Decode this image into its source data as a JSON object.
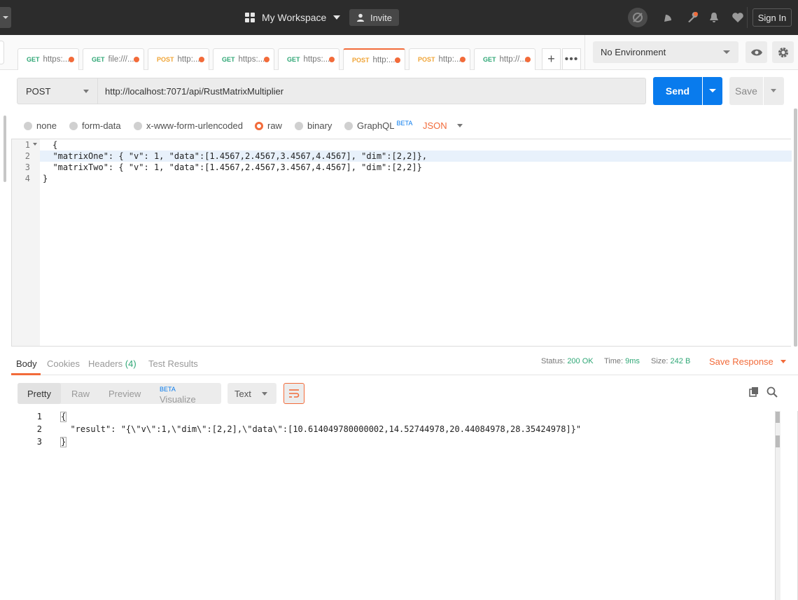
{
  "topbar": {
    "workspace": "My Workspace",
    "invite": "Invite",
    "sign_in": "Sign In",
    "icons": [
      "sync-off-icon",
      "satellite-icon",
      "wrench-icon",
      "bell-icon",
      "heart-icon"
    ]
  },
  "tabs": [
    {
      "method": "GET",
      "url": "https:..."
    },
    {
      "method": "GET",
      "url": "file:///..."
    },
    {
      "method": "POST",
      "url": "http:..."
    },
    {
      "method": "GET",
      "url": "https:..."
    },
    {
      "method": "GET",
      "url": "https:..."
    },
    {
      "method": "POST",
      "url": "http:...",
      "active": true
    },
    {
      "method": "POST",
      "url": "http:..."
    },
    {
      "method": "GET",
      "url": "http://..."
    }
  ],
  "environment": {
    "selected": "No Environment"
  },
  "request": {
    "method": "POST",
    "url": "http://localhost:7071/api/RustMatrixMultiplier",
    "send": "Send",
    "save": "Save"
  },
  "body_options": {
    "none": "none",
    "form_data": "form-data",
    "urlencoded": "x-www-form-urlencoded",
    "raw": "raw",
    "binary": "binary",
    "graphql": "GraphQL",
    "graphql_badge": "BETA",
    "format": "JSON"
  },
  "editor": {
    "line_numbers": [
      "1",
      "2",
      "3",
      "4"
    ],
    "lines": [
      "{",
      "  \"matrixOne\": { \"v\": 1, \"data\":[1.4567,2.4567,3.4567,4.4567], \"dim\":[2,2]},",
      "  \"matrixTwo\": { \"v\": 1, \"data\":[1.4567,2.4567,3.4567,4.4567], \"dim\":[2,2]}",
      "}"
    ]
  },
  "response": {
    "tabs": {
      "body": "Body",
      "cookies": "Cookies",
      "headers": "Headers",
      "headers_count": "(4)",
      "tests": "Test Results"
    },
    "status_label": "Status:",
    "status": "200 OK",
    "time_label": "Time:",
    "time": "9ms",
    "size_label": "Size:",
    "size": "242 B",
    "save_response": "Save Response",
    "views": {
      "pretty": "Pretty",
      "raw": "Raw",
      "preview": "Preview",
      "visualize": "Visualize",
      "visualize_badge": "BETA"
    },
    "format": "Text",
    "line_numbers": [
      "1",
      "2",
      "3"
    ],
    "lines": [
      "{",
      "  \"result\": \"{\\\"v\\\":1,\\\"dim\\\":[2,2],\\\"data\\\":[10.614049780000002,14.52744978,20.44084978,28.35424978]}\"",
      "}"
    ]
  },
  "colors": {
    "accent": "#f26b3a",
    "send": "#097bed",
    "get": "#2fa776",
    "post": "#f0a436"
  }
}
